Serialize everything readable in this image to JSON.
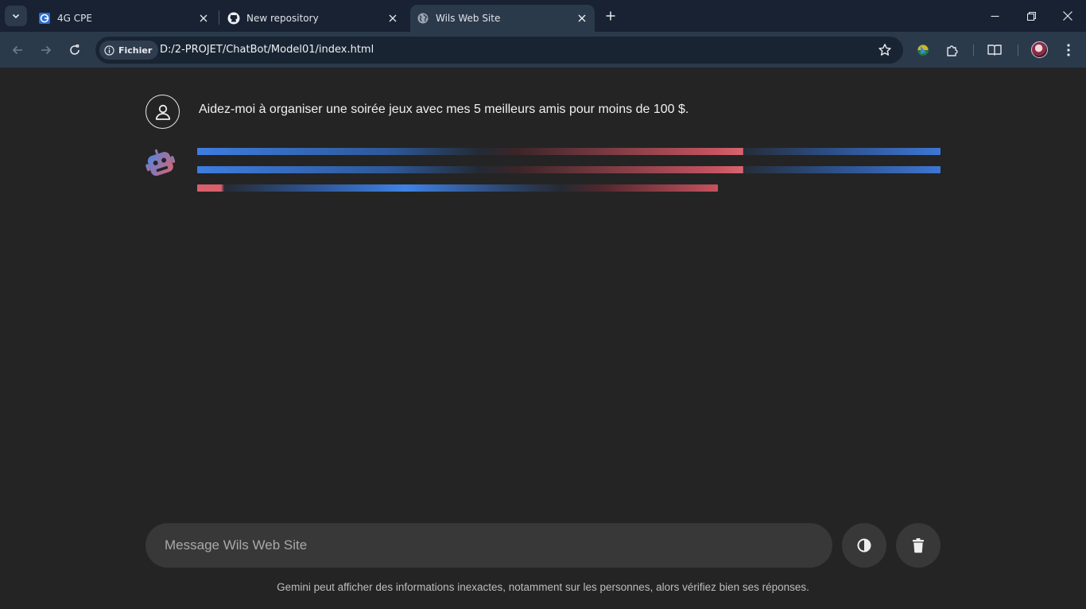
{
  "browser": {
    "tabs": [
      {
        "title": "4G CPE",
        "icon": "globe-blue-icon"
      },
      {
        "title": "New repository",
        "icon": "github-icon"
      },
      {
        "title": "Wils Web Site",
        "icon": "globe-icon",
        "active": true
      }
    ],
    "address": {
      "chip_label": "Fichier",
      "url": "D:/2-PROJET/ChatBot/Model01/index.html"
    }
  },
  "chat": {
    "messages": [
      {
        "role": "user",
        "text": "Aidez-moi à organiser une soirée jeux avec mes 5 meilleurs amis pour moins de 100 $."
      },
      {
        "role": "bot",
        "loading": true
      }
    ]
  },
  "composer": {
    "placeholder": "Message Wils Web Site",
    "theme_button_icon": "contrast-icon",
    "delete_button_icon": "trash-icon"
  },
  "footer": {
    "disclaimer": "Gemini peut afficher des informations inexactes, notamment sur les personnes, alors vérifiez bien ses réponses."
  },
  "colors": {
    "page_bg": "#242424",
    "tabstrip_bg": "#182232",
    "toolbar_bg": "#2b3a4b",
    "loader_blue": "#3e7de0",
    "loader_red": "#d9646f",
    "input_bg": "#383838"
  }
}
